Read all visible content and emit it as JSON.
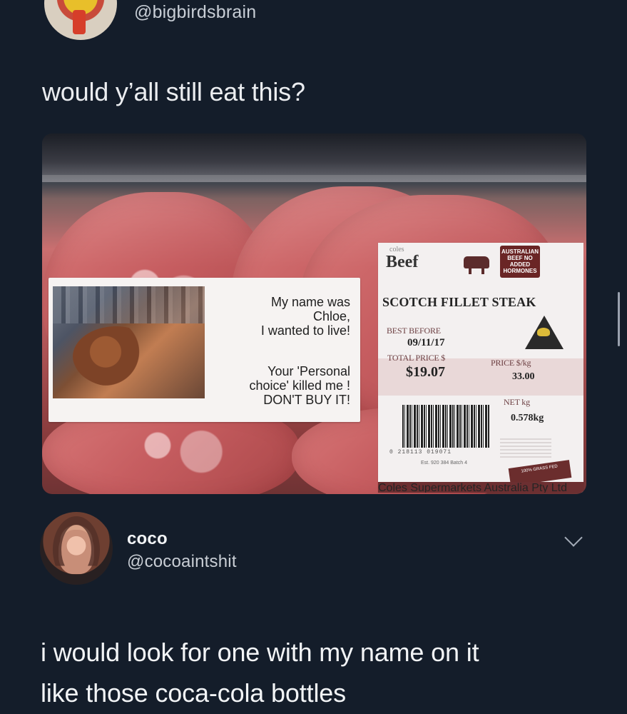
{
  "top_post": {
    "handle": "@bigbirdsbrain",
    "text": "would y’all still eat this?",
    "image": {
      "sticker": {
        "line1": "My name was",
        "line2": "Chloe,",
        "line3": "I wanted to live!",
        "line4": "Your 'Personal",
        "line5": "choice' killed me !",
        "line6": "DON'T BUY IT!"
      },
      "label": {
        "brand": "coles",
        "product_type": "Beef",
        "australian_badge": "AUSTRALIAN BEEF NO ADDED HORMONES",
        "title": "SCOTCH FILLET STEAK",
        "best_before_label": "BEST BEFORE",
        "best_before_value": "09/11/17",
        "total_price_label": "TOTAL PRICE $",
        "total_price_value": "$19.07",
        "price_per_kg_label": "PRICE $/kg",
        "price_per_kg_value": "33.00",
        "net_kg_label": "NET kg",
        "net_kg_value": "0.578kg",
        "barcode_digits": "0 218113 019071",
        "barcode_subtext": "Est. 920  384  Batch 4",
        "stamp_text": "100% GRASS FED",
        "footer_text": "Coles Supermarkets Australia Pty Ltd"
      }
    }
  },
  "reply": {
    "name": "coco",
    "handle": "@cocoaintshit",
    "text_line1": "i would look for one with my name on it",
    "text_line2": "like those coca-cola bottles"
  },
  "icons": {
    "menu": "chevron-down-icon"
  }
}
